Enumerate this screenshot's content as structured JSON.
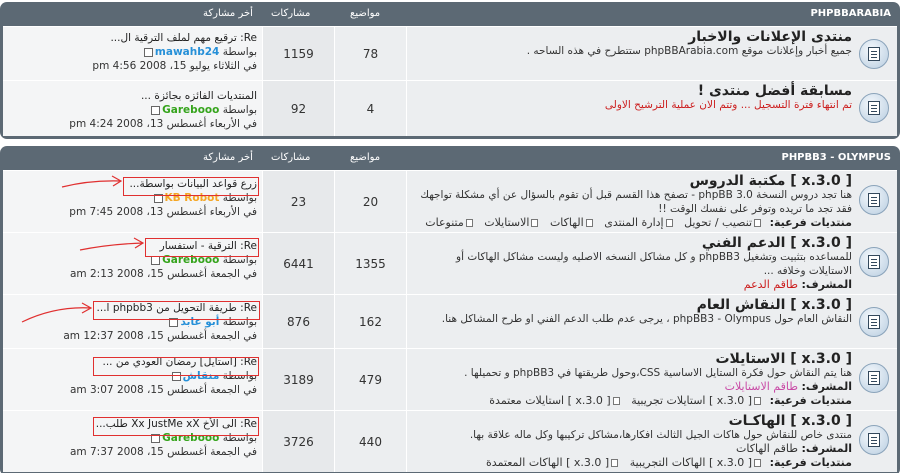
{
  "headers": {
    "col_topics": "مواضيع",
    "col_posts": "مشاركات",
    "col_last": "أخر مشاركة"
  },
  "categories": [
    {
      "name": "PHPBBARABIA",
      "forums": [
        {
          "title": "منتدى الإعلانات والاخبار",
          "desc": "جميع أخبار وإعلانات موقع phpBBArabia.com ستتطرح في هذه الساحه .",
          "topics": "78",
          "posts": "1159",
          "last_title": "Re: ترقيع مهم لملف الترقية ال...",
          "by": "بواسطة",
          "author": "mawahb24",
          "date": "في الثلاثاء يوليو 15، 2008 4:56 pm"
        },
        {
          "title": "مسابقة أفضل منتدى !",
          "desc": "تم انتهاء فترة التسجيل ... وتتم الان عملية الترشيح الاولى",
          "topics": "4",
          "posts": "92",
          "last_title": "المنتديات الفائزه بجائزة ...",
          "by": "بواسطة",
          "author": "Garebooo",
          "date": "في الأربعاء أغسطس 13، 2008 4:24 pm"
        }
      ]
    },
    {
      "name": "PHPBB3 - OLYMPUS",
      "forums": [
        {
          "title": "[ 3.0.x ] مكتبة الدروس",
          "desc": "هنا تجد دروس النسخة phpBB 3.0 - تصفح هذا القسم قبل أن تقوم بالسؤال عن أي مشكلة تواجهك فقد تجد ما تريده وتوفر على نفسك الوقت !!",
          "sub_label": "منتديات فرعية:",
          "subs": [
            "تنصيب / تحويل",
            "إدارة المنتدى",
            "الهاكات",
            "الاستايلات",
            "متنوعات"
          ],
          "topics": "20",
          "posts": "23",
          "last_title": "زرع قواعد البيانات بواسطة...",
          "by": "بواسطة",
          "author": "KB Robot",
          "date": "في الأربعاء أغسطس 13، 2008 7:45 pm"
        },
        {
          "title": "[ 3.0.x ] الدعم الفني",
          "desc": "للمساعده بتثبيت وتشغيل phpBB3 و كل مشاكل النسخه الاصليه وليست مشاكل الهاكات أو الاستايلات وخلافه ...",
          "mod_label": "المشرف:",
          "mod": "طاقم الدعم",
          "topics": "1355",
          "posts": "6441",
          "last_title": "Re: الترقية - استفسار",
          "by": "بواسطة",
          "author": "Garebooo",
          "date": "في الجمعة أغسطس 15، 2008 2:13 am"
        },
        {
          "title": "[ 3.0.x ] النقاش العام",
          "desc": "النقاش العام حول phpBB3 - Olympus ، يرجى عدم طلب الدعم الفني او طرح المشاكل هنا.",
          "topics": "162",
          "posts": "876",
          "last_title": "Re: طريقة التحويل من phpbb3 ا...",
          "by": "بواسطة",
          "author": "أبو عابد",
          "date": "في الجمعة أغسطس 15، 2008 12:37 am"
        },
        {
          "title": "[ 3.0.x ] الاستايلات",
          "desc": "هنا يتم النقاش حول فكرة الستايل الاساسية CSS،وحول طريقتها في phpBB3 و تحميلها .",
          "mod_label": "المشرف:",
          "mod": "طاقم الاستايلات",
          "sub_label": "منتديات فرعية:",
          "subs": [
            "[ 3.0.x ] استايلات تجريبية",
            "[ 3.0.x ] استايلات معتمدة"
          ],
          "topics": "479",
          "posts": "3189",
          "last_title": "Re: [استايل] رمضان العودي من ...",
          "by": "بواسطة",
          "author": "منقاش",
          "date": "في الجمعة أغسطس 15، 2008 3:07 am"
        },
        {
          "title": "[ 3.0.x ] الهاكـات",
          "desc": "منتدى خاص للنقاش حول هاكات الجيل الثالث افكارها،مشاكل تركيبها وكل ماله علاقة بها.",
          "mod_label": "المشرف:",
          "mod": "طاقم الهاكات",
          "sub_label": "منتديات فرعية:",
          "subs": [
            "[ 3.0.x ] الهاكات التجريبية",
            "[ 3.0.x ] الهاكات المعتمدة"
          ],
          "topics": "440",
          "posts": "3726",
          "last_title": "Re: الى الأخ Xx JustMe xX طلب...",
          "by": "بواسطة",
          "author": "Garebooo",
          "date": "في الجمعة أغسطس 15، 2008 7:37 am"
        }
      ]
    }
  ],
  "colors": {
    "panel": "#5c6974",
    "row": "#eceef0",
    "highlight": "#e03030",
    "author_blue": "#2690d8",
    "author_green": "#35a41c",
    "author_orange": "#f5a623"
  },
  "icons": [
    "forum-read-icon",
    "forum-locked-icon",
    "post-icon",
    "subforum-icon"
  ]
}
